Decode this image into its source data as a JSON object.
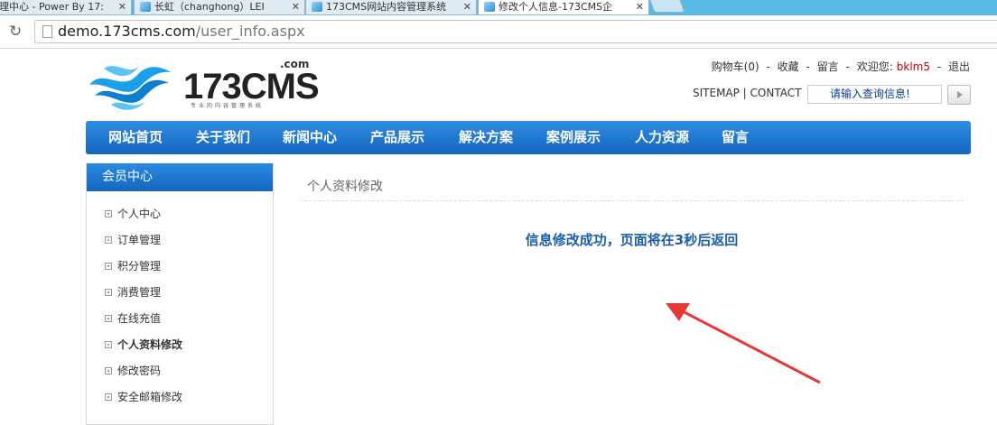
{
  "browser": {
    "tabs": [
      {
        "title": "理中心 - Power By 17:",
        "active": false
      },
      {
        "title": "长虹（changhong）LEI",
        "active": false
      },
      {
        "title": "173CMS网站内容管理系统",
        "active": false
      },
      {
        "title": "修改个人信息-173CMS企",
        "active": true
      }
    ],
    "tab_close": "✕",
    "url_host": "demo.173cms.com",
    "url_path": "/user_info.aspx"
  },
  "header": {
    "logo_text": "173CMS",
    "logo_com": ".com",
    "logo_slogan": "专业的内容管理系统",
    "links": {
      "cart": "购物车(0)",
      "favorite": "收藏",
      "message": "留言",
      "welcome": "欢迎您:",
      "username": "bklm5",
      "logout": "退出",
      "sep": "-"
    },
    "sitemap": "SITEMAP | CONTACT",
    "search_placeholder": "请输入查询信息!"
  },
  "nav": {
    "items": [
      "网站首页",
      "关于我们",
      "新闻中心",
      "产品展示",
      "解决方案",
      "案例展示",
      "人力资源",
      "留言"
    ]
  },
  "sidebar": {
    "title": "会员中心",
    "items": [
      {
        "label": "个人中心",
        "current": false
      },
      {
        "label": "订单管理",
        "current": false
      },
      {
        "label": "积分管理",
        "current": false
      },
      {
        "label": "消费管理",
        "current": false
      },
      {
        "label": "在线充值",
        "current": false
      },
      {
        "label": "个人资料修改",
        "current": true
      },
      {
        "label": "修改密码",
        "current": false
      },
      {
        "label": "安全邮箱修改",
        "current": false
      }
    ]
  },
  "main": {
    "title": "个人资料修改",
    "message": "信息修改成功，页面将在3秒后返回"
  },
  "colors": {
    "nav_blue": "#1f78d1",
    "message_blue": "#1a5fa8",
    "arrow_red": "#e53935",
    "username_red": "#cc0000"
  }
}
